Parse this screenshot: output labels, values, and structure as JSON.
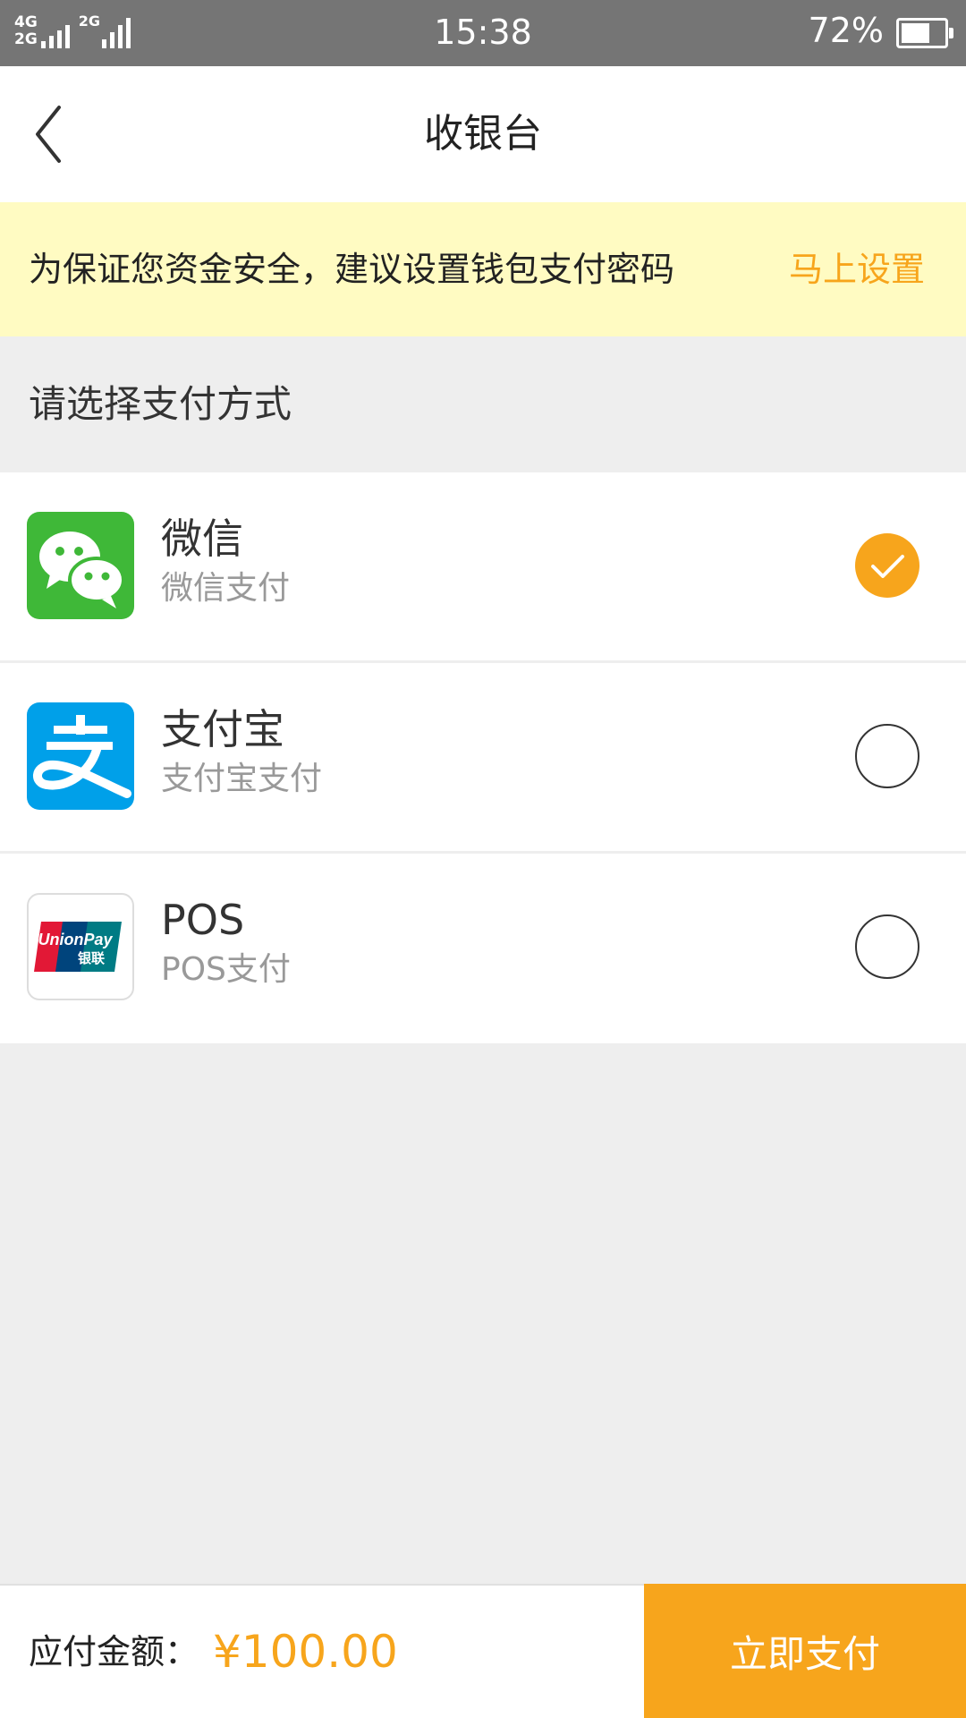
{
  "status_bar": {
    "network_top": "4G",
    "network_bottom": "2G",
    "network_second": "2G",
    "time": "15:38",
    "battery_percent_text": "72%",
    "battery_level": 0.72
  },
  "header": {
    "title": "收银台",
    "back_icon": "chevron-left-icon"
  },
  "notice": {
    "text": "为保证您资金安全，建议设置钱包支付密码",
    "action_label": "马上设置"
  },
  "section": {
    "label": "请选择支付方式"
  },
  "payment_methods": [
    {
      "title": "微信",
      "subtitle": "微信支付",
      "icon": "wechat-icon",
      "selected": true
    },
    {
      "title": "支付宝",
      "subtitle": "支付宝支付",
      "icon": "alipay-icon",
      "selected": false
    },
    {
      "title": "POS",
      "subtitle": "POS支付",
      "icon": "unionpay-icon",
      "selected": false
    }
  ],
  "footer": {
    "amount_label": "应付金额：",
    "amount_value": "¥100.00",
    "pay_button_label": "立即支付"
  },
  "colors": {
    "accent": "#f7a51c",
    "notice_bg": "#fffbc2",
    "wechat": "#3fb838",
    "alipay": "#00a0e9",
    "page_bg": "#eeeeee"
  }
}
